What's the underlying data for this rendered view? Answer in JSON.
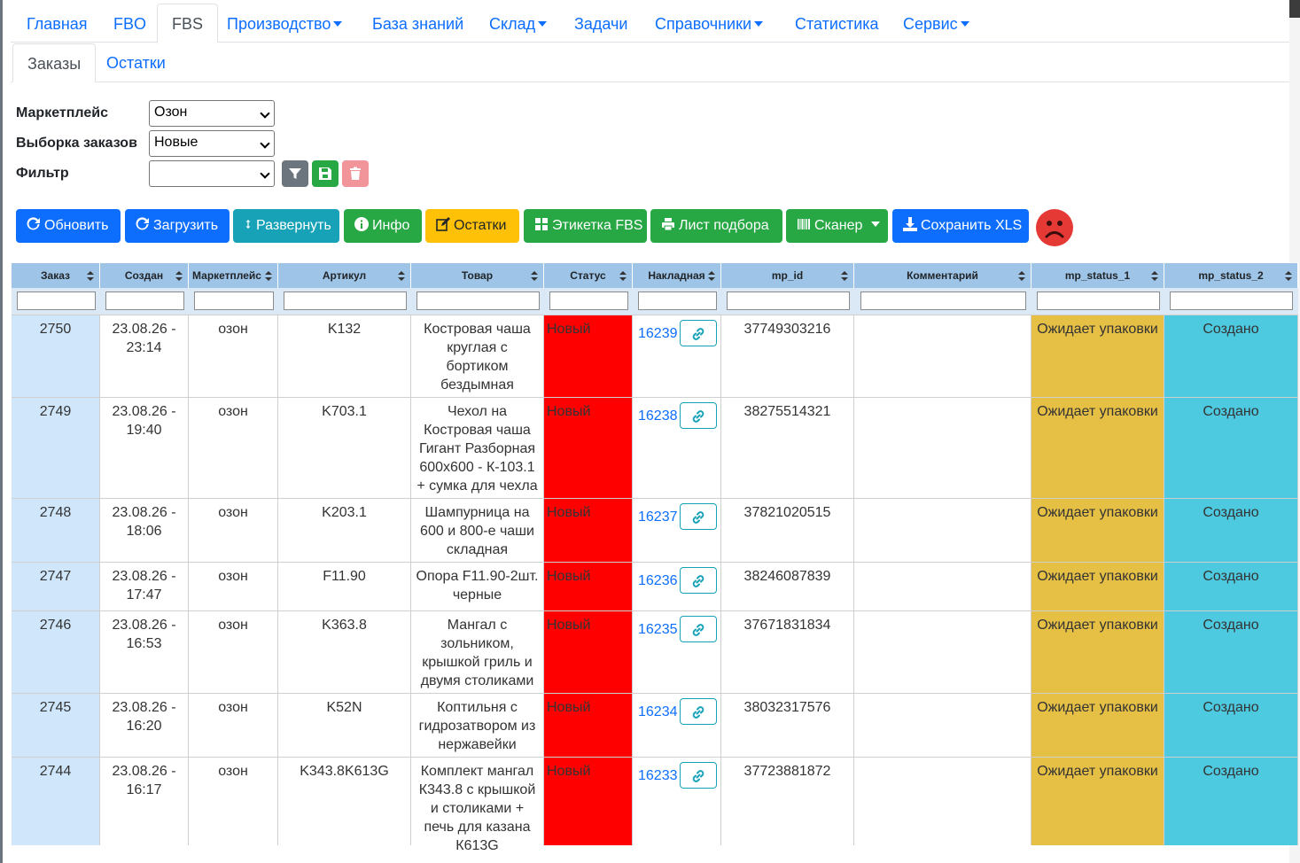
{
  "nav": {
    "tabs": [
      "Главная",
      "FBO",
      "FBS",
      "Производство",
      "База знаний",
      "Склад",
      "Задачи",
      "Справочники",
      "Статистика",
      "Сервис"
    ]
  },
  "subnav": {
    "tabs": [
      "Заказы",
      "Остатки"
    ]
  },
  "filters": {
    "marketplace_label": "Маркетплейс",
    "marketplace_value": "Озон",
    "selection_label": "Выборка заказов",
    "selection_value": "Новые",
    "filter_label": "Фильтр",
    "filter_value": ""
  },
  "actions": {
    "refresh": "Обновить",
    "load": "Загрузить",
    "expand": "Развернуть",
    "info": "Инфо",
    "stock": "Остатки",
    "label_fbs": "Этикетка FBS",
    "pick_list": "Лист подбора",
    "scanner": "Сканер",
    "save_xls": "Сохранить XLS"
  },
  "table": {
    "headers": [
      "Заказ",
      "Создан",
      "Маркетплейс",
      "Артикул",
      "Товар",
      "Статус",
      "Накладная",
      "mp_id",
      "Комментарий",
      "mp_status_1",
      "mp_status_2"
    ],
    "rows": [
      {
        "order": "2750",
        "created": "23.08.26 - 23:14",
        "mp": "озон",
        "sku": "K132",
        "product": "Костровая чаша круглая с бортиком бездымная",
        "status": "Новый",
        "invoice": "16239",
        "mp_id": "37749303216",
        "comment": "",
        "st1": "Ожидает упаковки",
        "st2": "Создано"
      },
      {
        "order": "2749",
        "created": "23.08.26 - 19:40",
        "mp": "озон",
        "sku": "K703.1",
        "product": "Чехол на Костровая чаша Гигант Разборная 600х600 - К-103.1 + сумка для чехла",
        "status": "Новый",
        "invoice": "16238",
        "mp_id": "38275514321",
        "comment": "",
        "st1": "Ожидает упаковки",
        "st2": "Создано"
      },
      {
        "order": "2748",
        "created": "23.08.26 - 18:06",
        "mp": "озон",
        "sku": "K203.1",
        "product": "Шампурница на 600 и 800-е чаши складная",
        "status": "Новый",
        "invoice": "16237",
        "mp_id": "37821020515",
        "comment": "",
        "st1": "Ожидает упаковки",
        "st2": "Создано"
      },
      {
        "order": "2747",
        "created": "23.08.26 - 17:47",
        "mp": "озон",
        "sku": "F11.90",
        "product": "Опора F11.90-2шт. черные",
        "status": "Новый",
        "invoice": "16236",
        "mp_id": "38246087839",
        "comment": "",
        "st1": "Ожидает упаковки",
        "st2": "Создано"
      },
      {
        "order": "2746",
        "created": "23.08.26 - 16:53",
        "mp": "озон",
        "sku": "K363.8",
        "product": "Мангал с зольником, крышкой гриль и двумя столиками",
        "status": "Новый",
        "invoice": "16235",
        "mp_id": "37671831834",
        "comment": "",
        "st1": "Ожидает упаковки",
        "st2": "Создано"
      },
      {
        "order": "2745",
        "created": "23.08.26 - 16:20",
        "mp": "озон",
        "sku": "K52N",
        "product": "Коптильня с гидрозатвором из нержавейки",
        "status": "Новый",
        "invoice": "16234",
        "mp_id": "38032317576",
        "comment": "",
        "st1": "Ожидает упаковки",
        "st2": "Создано"
      },
      {
        "order": "2744",
        "created": "23.08.26 - 16:17",
        "mp": "озон",
        "sku": "K343.8K613G",
        "product": "Комплект мангал К343.8 с крышкой и столиками + печь для казана К613G",
        "status": "Новый",
        "invoice": "16233",
        "mp_id": "37723881872",
        "comment": "",
        "st1": "Ожидает упаковки",
        "st2": "Создано"
      }
    ]
  },
  "colors": {
    "primary": "#0d6efd",
    "status_new": "#ff0000",
    "mp_status_1_bg": "#e6bf45",
    "mp_status_2_bg": "#4dc9e0",
    "order_col_bg": "#cfe6fb",
    "header_bg": "#9ec5e8"
  }
}
